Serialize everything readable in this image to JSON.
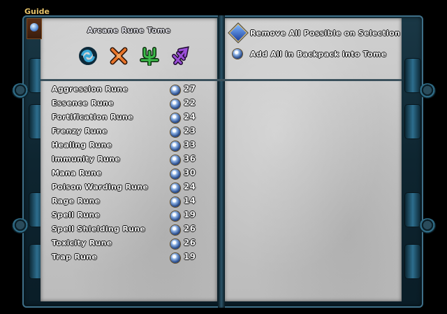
{
  "guide": {
    "label": "Guide"
  },
  "tome": {
    "title": "Arcane Rune Tome",
    "category_icons": [
      {
        "name": "water-swirl-rune-icon",
        "color": "#3aa7d6"
      },
      {
        "name": "crossed-swords-rune-icon",
        "color": "#e8742a"
      },
      {
        "name": "trident-rune-icon",
        "color": "#3dba4a"
      },
      {
        "name": "arcane-sigil-rune-icon",
        "color": "#9b4fd8"
      }
    ]
  },
  "runes": [
    {
      "name": "Aggression Rune",
      "count": "27"
    },
    {
      "name": "Essence Rune",
      "count": "22"
    },
    {
      "name": "Fortification Rune",
      "count": "24"
    },
    {
      "name": "Frenzy Rune",
      "count": "23"
    },
    {
      "name": "Healing Rune",
      "count": "33"
    },
    {
      "name": "Immunity Rune",
      "count": "36"
    },
    {
      "name": "Mana Rune",
      "count": "30"
    },
    {
      "name": "Poison Warding Rune",
      "count": "24"
    },
    {
      "name": "Rage Rune",
      "count": "14"
    },
    {
      "name": "Spell Rune",
      "count": "19"
    },
    {
      "name": "Spell Shielding Rune",
      "count": "26"
    },
    {
      "name": "Toxicity Rune",
      "count": "26"
    },
    {
      "name": "Trap Rune",
      "count": "19"
    }
  ],
  "actions": {
    "remove_label": "Remove All Possible on Selection",
    "add_label": "Add All in Backpack into Tome"
  }
}
